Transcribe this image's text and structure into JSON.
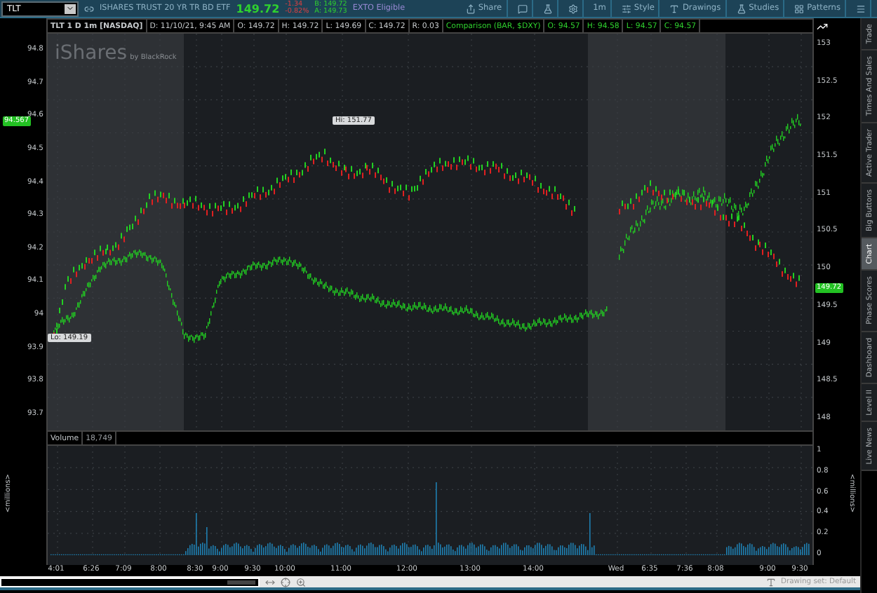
{
  "symbol": {
    "value": "TLT"
  },
  "quote": {
    "description": "ISHARES TRUST 20 YR TR BD ETF",
    "last": "149.72",
    "change": "-1.34",
    "change_percent": "-0.82%",
    "bid": "B: 149.72",
    "ask": "A: 149.73",
    "badge": "EXTO Eligible"
  },
  "toolbar": [
    {
      "kind": "labeled",
      "label": "Share"
    },
    {
      "kind": "icon"
    },
    {
      "kind": "icon"
    },
    {
      "kind": "icon"
    },
    {
      "kind": "text",
      "label": "1m"
    },
    {
      "kind": "labeled",
      "label": "Style"
    },
    {
      "kind": "labeled",
      "label": "Drawings"
    },
    {
      "kind": "labeled",
      "label": "Studies"
    },
    {
      "kind": "labeled",
      "label": "Patterns"
    },
    {
      "kind": "icon"
    }
  ],
  "chart_header": {
    "title": "TLT 1 D 1m [NASDAQ]",
    "fields": [
      "D: 11/10/21, 9:45 AM",
      "O: 149.72",
      "H: 149.72",
      "L: 149.69",
      "C: 149.72",
      "R: 0.03"
    ],
    "comparison": "Comparison (BAR, $DXY)",
    "comparison_fields": [
      "O: 94.57",
      "H: 94.58",
      "L: 94.57",
      "C: 94.57"
    ]
  },
  "price_pane": {
    "watermark": "iShares",
    "watermark_sub": "by BlackRock",
    "left_axis": [
      "94.8",
      "94.7",
      "94.6",
      "94.5",
      "94.4",
      "94.3",
      "94.2",
      "94.1",
      "94",
      "93.9",
      "93.8",
      "93.7"
    ],
    "right_axis": [
      "153",
      "152.5",
      "152",
      "151.5",
      "151",
      "150.5",
      "150",
      "149.5",
      "149",
      "148.5",
      "148"
    ],
    "high_label": "Hi: 151.77",
    "low_label": "Lo: 149.19",
    "comparison_price": "94.567",
    "last_price": "149.72"
  },
  "volume_pane": {
    "title": "Volume",
    "value": "18,749",
    "unit_left": "<millions>",
    "unit_right": "<millions>",
    "axis": [
      "1",
      "0.8",
      "0.6",
      "0.4",
      "0.2",
      "0"
    ]
  },
  "time_axis": [
    "4:01",
    "6:26",
    "7:09",
    "8:00",
    "8:30",
    "9:00",
    "9:30",
    "10:00",
    "11:00",
    "12:00",
    "13:00",
    "14:00",
    "Wed",
    "6:35",
    "7:36",
    "8:08",
    "9:00",
    "9:30"
  ],
  "status_bar": {
    "drawing_set": "Drawing set: Default"
  },
  "side_tabs": [
    {
      "label": "Trade",
      "selected": false
    },
    {
      "label": "Times And Sales",
      "selected": false
    },
    {
      "label": "Active Trader",
      "selected": false
    },
    {
      "label": "Big Buttons",
      "selected": false
    },
    {
      "label": "Chart",
      "selected": true
    },
    {
      "label": "Phase Scores",
      "selected": false
    },
    {
      "label": "Dashboard",
      "selected": false
    },
    {
      "label": "Level II",
      "selected": false
    },
    {
      "label": "Live News",
      "selected": false
    }
  ]
}
